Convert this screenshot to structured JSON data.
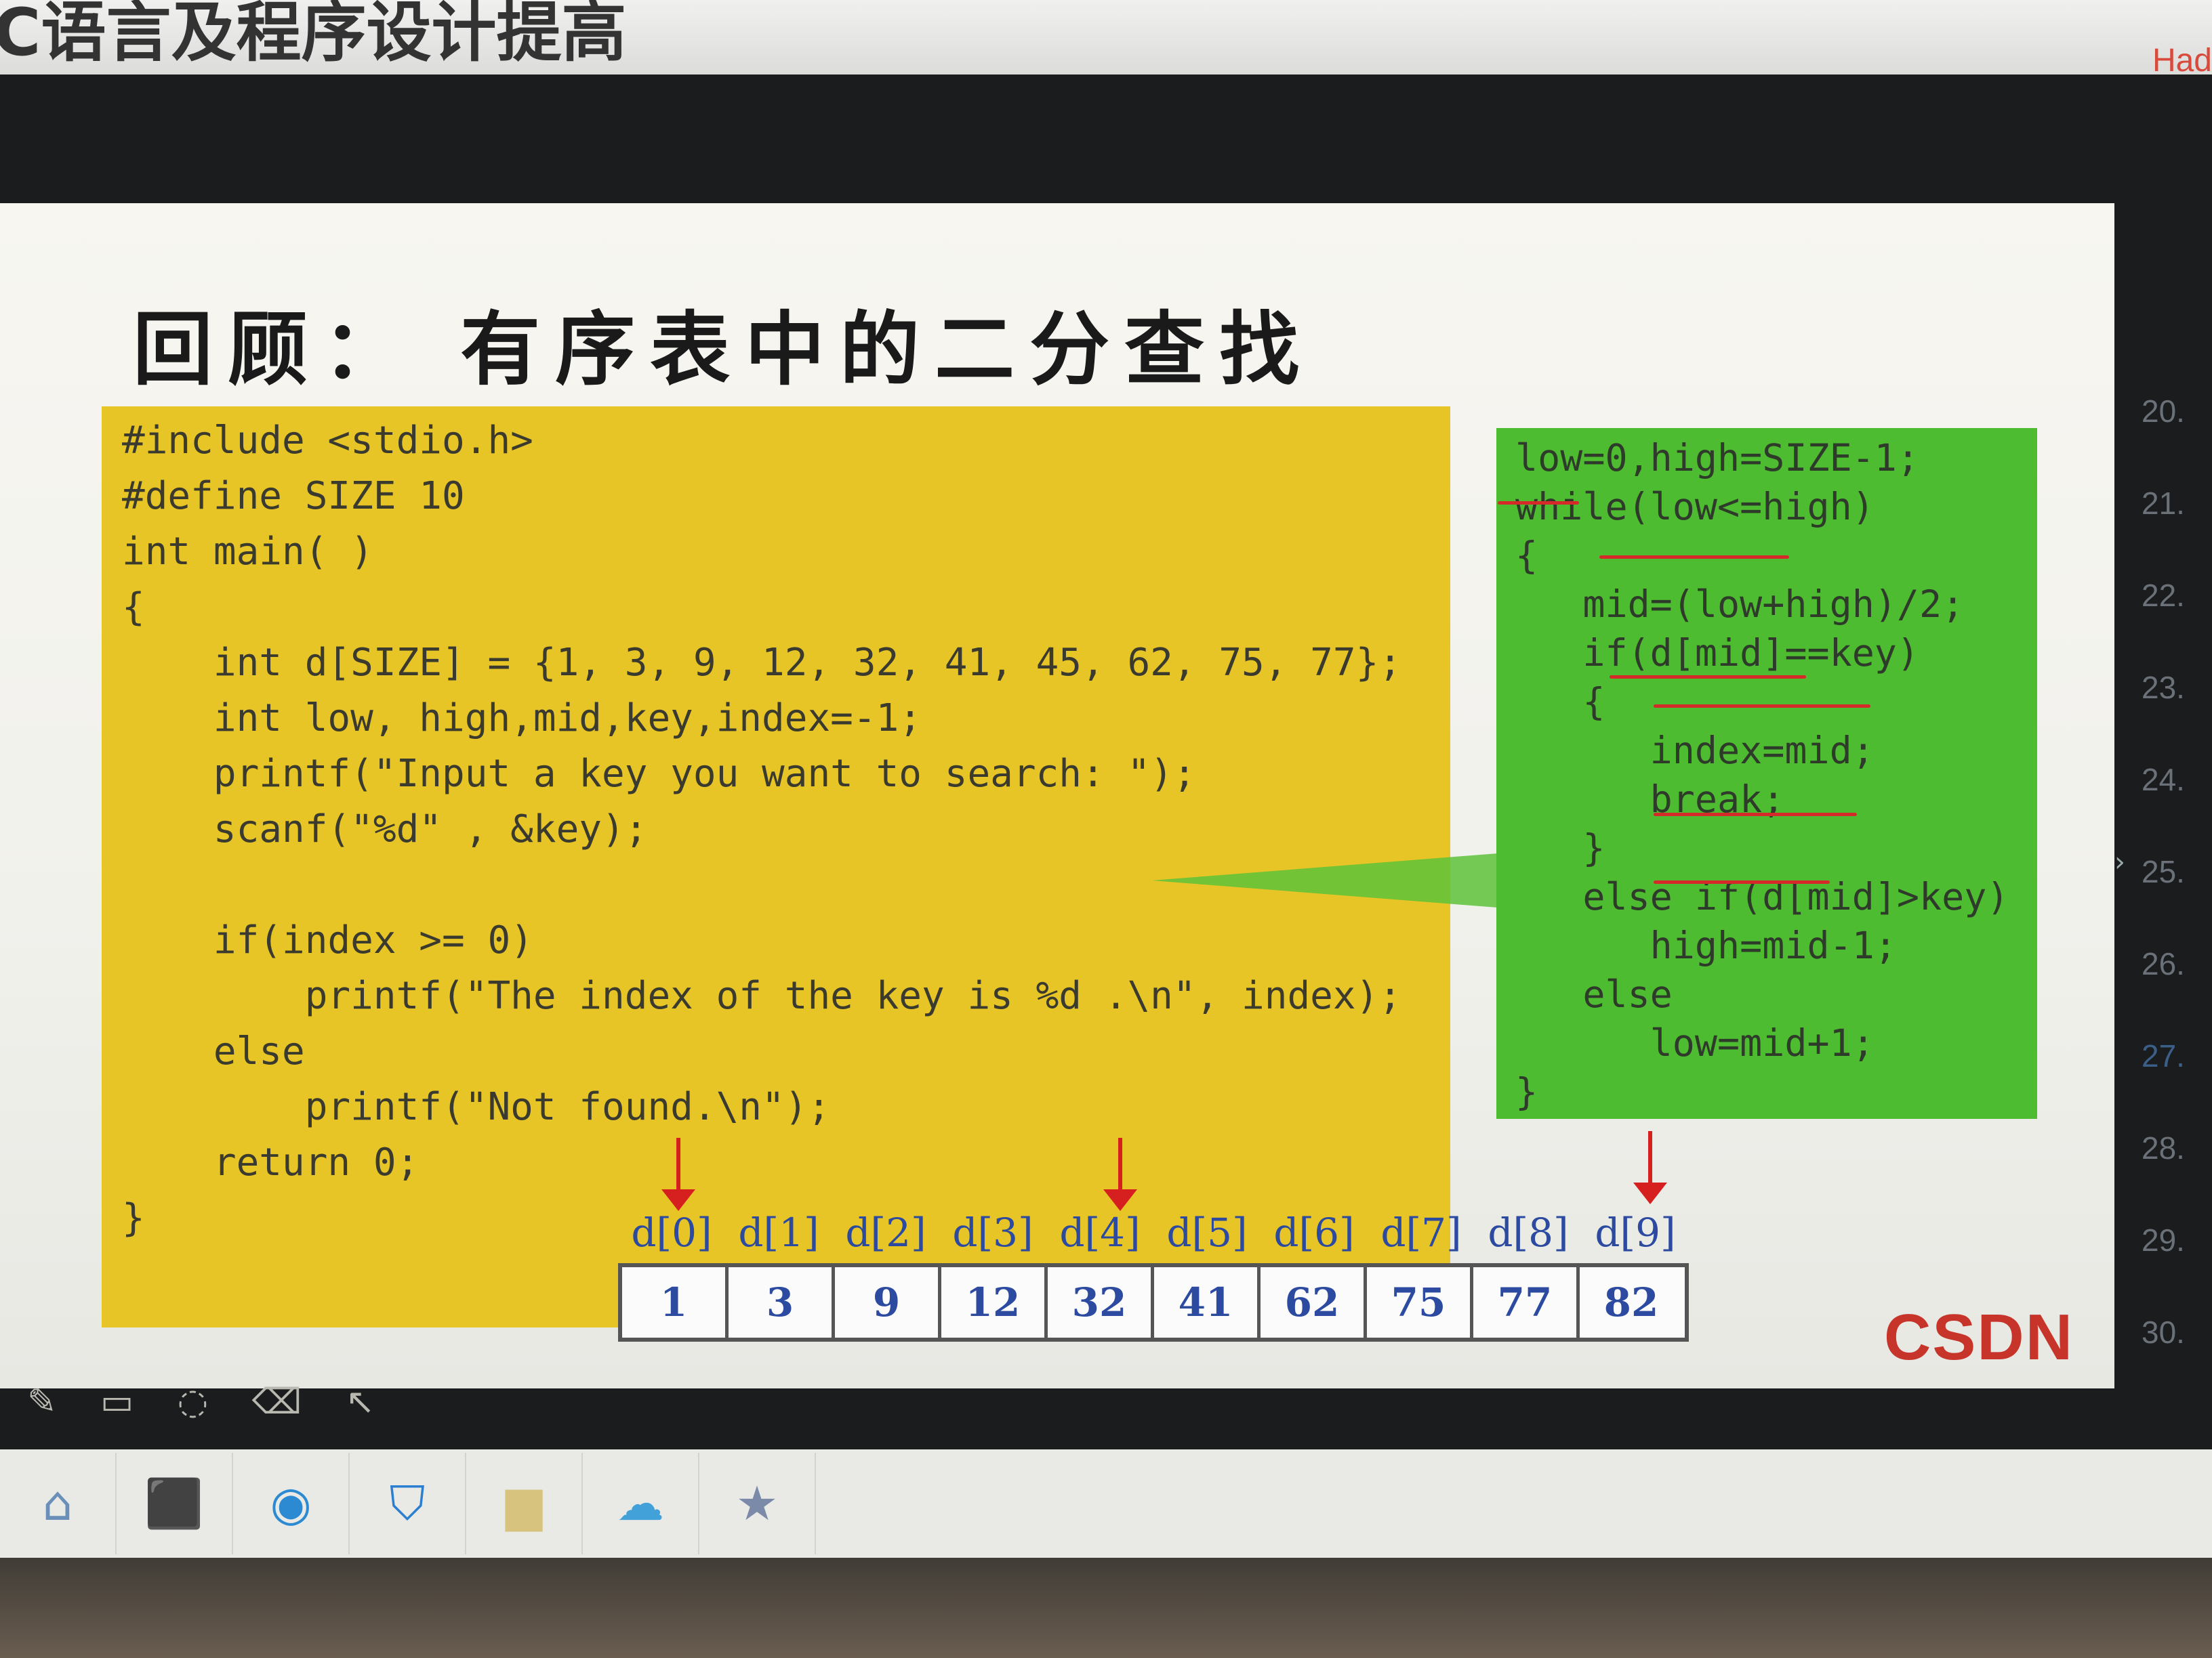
{
  "header": {
    "course_title": "C语言及程序设计提高",
    "user_name": "Had"
  },
  "slide": {
    "title": "回顾： 有序表中的二分查找",
    "main_code": [
      "#include <stdio.h>",
      "#define SIZE 10",
      "int main( )",
      "{",
      "    int d[SIZE] = {1, 3, 9, 12, 32, 41, 45, 62, 75, 77};",
      "    int low, high,mid,key,index=-1;",
      "    printf(\"Input a key you want to search: \");",
      "    scanf(\"%d\" , &key);",
      "",
      "    if(index >= 0)",
      "        printf(\"The index of the key is %d .\\n\", index);",
      "    else",
      "        printf(\"Not found.\\n\");",
      "    return 0;",
      "}"
    ],
    "search_code": [
      "low=0,high=SIZE-1;",
      "while(low<=high)",
      "{",
      "   mid=(low+high)/2;",
      "   if(d[mid]==key)",
      "   {",
      "      index=mid;",
      "      break;",
      "   }",
      "   else if(d[mid]>key)",
      "      high=mid-1;",
      "   else",
      "      low=mid+1;",
      "}"
    ],
    "array": {
      "indices": [
        "d[0]",
        "d[1]",
        "d[2]",
        "d[3]",
        "d[4]",
        "d[5]",
        "d[6]",
        "d[7]",
        "d[8]",
        "d[9]"
      ],
      "values": [
        "1",
        "3",
        "9",
        "12",
        "32",
        "41",
        "62",
        "75",
        "77",
        "82"
      ]
    },
    "watermark": "CSDN"
  },
  "side_list": {
    "slides": [
      "20",
      "21",
      "22",
      "23",
      "24",
      "25",
      "26",
      "27",
      "28",
      "29",
      "30"
    ],
    "active": "27"
  },
  "pen_tools": "✎ ▭ ◌ ⌫ ↖",
  "taskbar": {
    "items": [
      {
        "name": "home-icon",
        "glyph": "⌂",
        "color": "#6a8fb8"
      },
      {
        "name": "pdf-reader-icon",
        "glyph": "⬛",
        "color": "#b51e1e"
      },
      {
        "name": "browser-icon",
        "glyph": "◉",
        "color": "#2b8ad1"
      },
      {
        "name": "security-shield-icon",
        "glyph": "⛉",
        "color": "#2b7fd0"
      },
      {
        "name": "folder-icon",
        "glyph": "▆",
        "color": "#d7c27e"
      },
      {
        "name": "cloud-sync-icon",
        "glyph": "☁",
        "color": "#42a1d8"
      },
      {
        "name": "favorites-star-icon",
        "glyph": "★",
        "color": "#7a8aa8"
      }
    ]
  }
}
